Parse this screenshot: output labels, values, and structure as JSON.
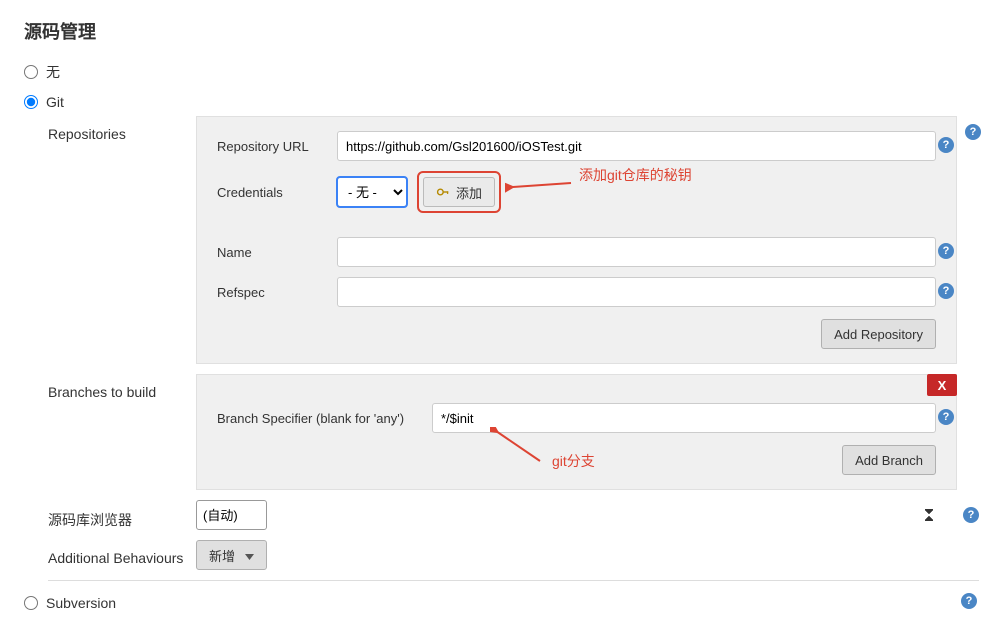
{
  "section_title": "源码管理",
  "scm_options": {
    "none": {
      "label": "无",
      "checked": false
    },
    "git": {
      "label": "Git",
      "checked": true
    },
    "svn": {
      "label": "Subversion",
      "checked": false
    }
  },
  "repositories": {
    "label": "Repositories",
    "repo_url": {
      "label": "Repository URL",
      "value": "https://github.com/Gsl201600/iOSTest.git"
    },
    "credentials": {
      "label": "Credentials",
      "selected": "- 无 -",
      "add_label": "添加"
    },
    "name": {
      "label": "Name",
      "value": ""
    },
    "refspec": {
      "label": "Refspec",
      "value": ""
    },
    "add_repo_label": "Add Repository"
  },
  "branches": {
    "label": "Branches to build",
    "specifier": {
      "label": "Branch Specifier (blank for 'any')",
      "value": "*/$init"
    },
    "delete_label": "X",
    "add_branch_label": "Add Branch"
  },
  "browser": {
    "label": "源码库浏览器",
    "selected": "(自动)"
  },
  "additional": {
    "label": "Additional Behaviours",
    "add_label": "新增"
  },
  "annotations": {
    "cred_hint": "添加git仓库的秘钥",
    "branch_hint": "git分支"
  },
  "help_tooltip": "?"
}
